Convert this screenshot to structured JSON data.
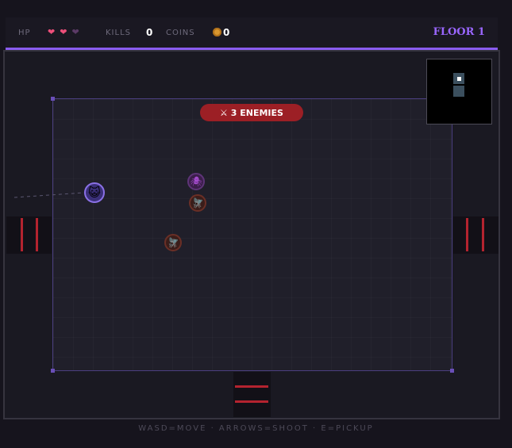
{
  "hud": {
    "hp_label": "HP",
    "hearts": [
      "full",
      "full",
      "empty"
    ],
    "kills_label": "KILLS",
    "kills_value": "0",
    "coins_label": "COINS",
    "coins_value": "0",
    "floor_label": "FLOOR 1"
  },
  "room": {
    "enemies_banner": "⚔ 3 ENEMIES",
    "enemy_count": 3,
    "player_icon": "cat-face-icon",
    "enemies": [
      "spider",
      "fly",
      "fly"
    ]
  },
  "minimap": {
    "current_room": "visible"
  },
  "footer": {
    "controls": "WASD=MOVE · ARROWS=SHOOT · E=PICKUP"
  },
  "colors": {
    "accent": "#8a5cf0",
    "heart": "#ee4f7a",
    "banner": "#9c1f25",
    "door": "#b4232f"
  }
}
